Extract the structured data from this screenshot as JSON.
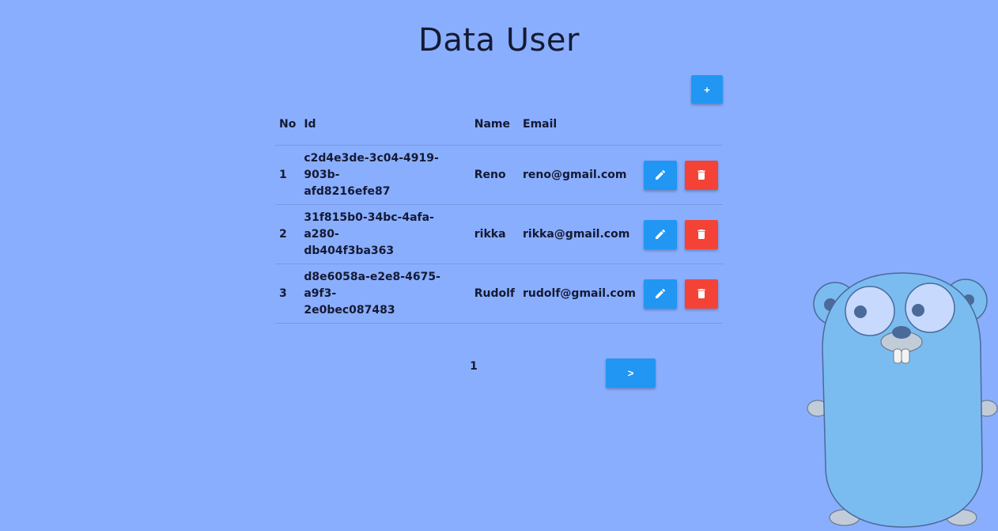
{
  "header": {
    "title": "Data User"
  },
  "toolbar": {
    "add_label": "+"
  },
  "table": {
    "columns": [
      "No",
      "Id",
      "Name",
      "Email",
      ""
    ],
    "rows": [
      {
        "no": "1",
        "id_line1": "c2d4e3de-3c04-4919-903b-",
        "id_line2": "afd8216efe87",
        "name": "Reno",
        "email": "reno@gmail.com"
      },
      {
        "no": "2",
        "id_line1": "31f815b0-34bc-4afa-a280-",
        "id_line2": "db404f3ba363",
        "name": "rikka",
        "email": "rikka@gmail.com"
      },
      {
        "no": "3",
        "id_line1": "d8e6058a-e2e8-4675-a9f3-",
        "id_line2": "2e0bec087483",
        "name": "Rudolf",
        "email": "rudolf@gmail.com"
      }
    ]
  },
  "pagination": {
    "current_page": "1",
    "next_label": ">"
  },
  "colors": {
    "background": "#8aaefe",
    "primary": "#2196f3",
    "danger": "#f44336",
    "gopher_body": "#7bbcf0"
  },
  "icons": {
    "edit": "pencil-icon",
    "delete": "trash-icon",
    "mascot": "gopher-mascot"
  }
}
